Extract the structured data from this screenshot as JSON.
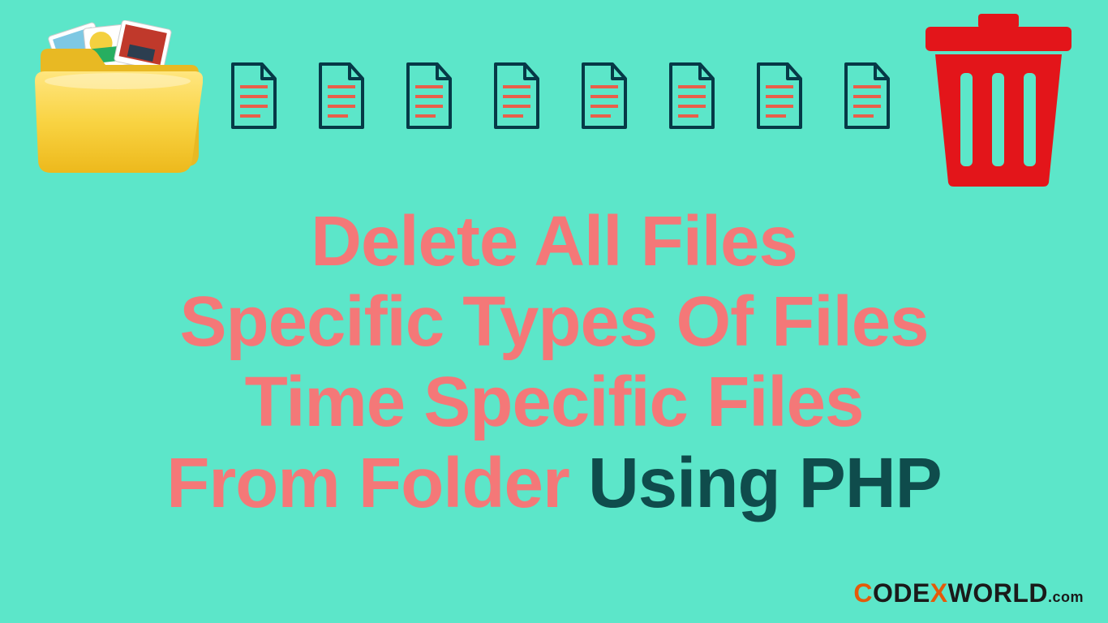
{
  "heading": {
    "line1": "Delete All Files",
    "line2": "Specific Types Of Files",
    "line3": "Time Specific Files",
    "line4a": "From Folder ",
    "line4b": "Using PHP"
  },
  "watermark": {
    "part1": "C",
    "part2": "ODE",
    "part3": "X",
    "part4": "WORLD",
    "suffix": ".com"
  },
  "icons": {
    "folder": "folder-with-photos",
    "file": "document-file",
    "trash": "trash-can",
    "file_count": 8
  }
}
